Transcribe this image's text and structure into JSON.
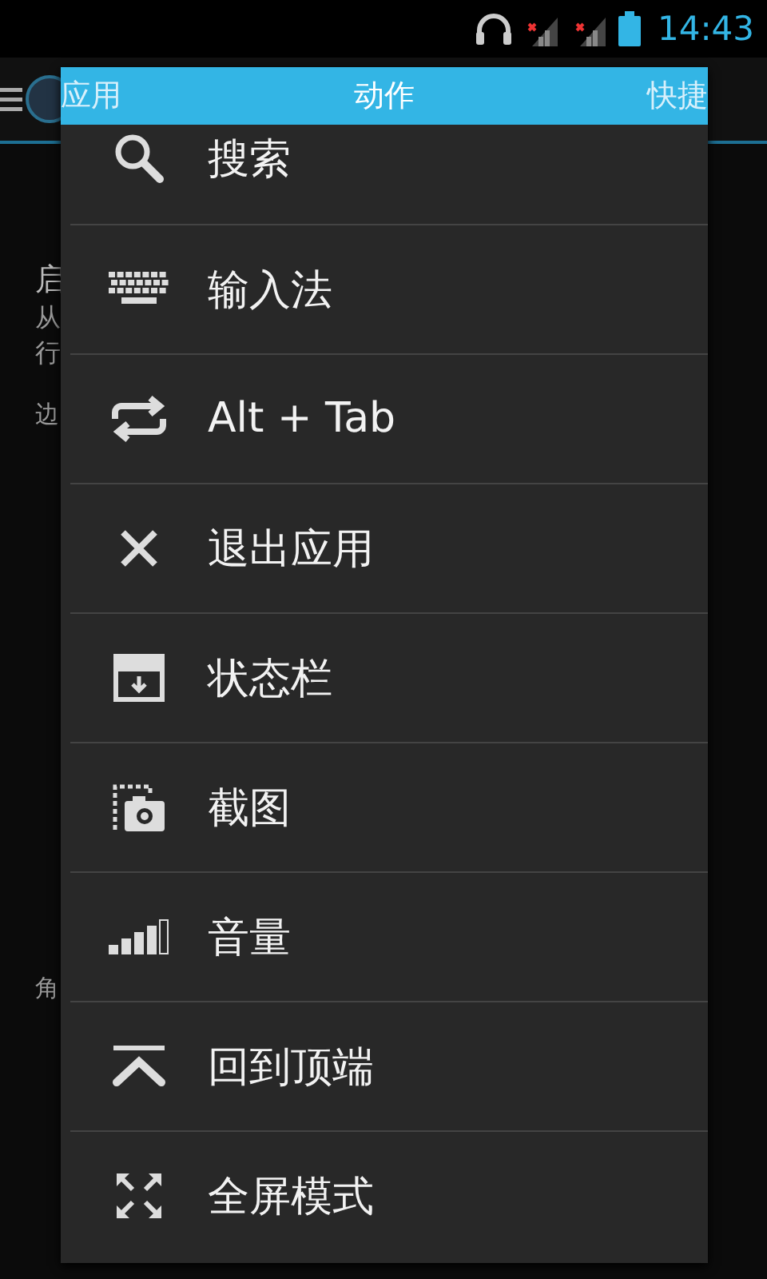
{
  "status_bar": {
    "time": "14:43"
  },
  "background": {
    "texts": [
      {
        "kind": "title",
        "text": "启"
      },
      {
        "kind": "sub",
        "text": "从"
      },
      {
        "kind": "sub",
        "text": "行"
      },
      {
        "kind": "header",
        "text": "边"
      },
      {
        "kind": "header",
        "text": "角"
      }
    ]
  },
  "popup": {
    "tabs": [
      {
        "label": "应用",
        "selected": false
      },
      {
        "label": "动作",
        "selected": true
      },
      {
        "label": "快捷",
        "selected": false
      }
    ],
    "items": [
      {
        "kind": "search",
        "label": "搜索"
      },
      {
        "kind": "keyboard",
        "label": "输入法"
      },
      {
        "kind": "switch",
        "label": "Alt + Tab"
      },
      {
        "kind": "close",
        "label": "退出应用"
      },
      {
        "kind": "statusbar",
        "label": "状态栏"
      },
      {
        "kind": "screenshot",
        "label": "截图"
      },
      {
        "kind": "volume",
        "label": "音量"
      },
      {
        "kind": "top",
        "label": "回到顶端"
      },
      {
        "kind": "fullscreen",
        "label": "全屏模式"
      }
    ]
  }
}
